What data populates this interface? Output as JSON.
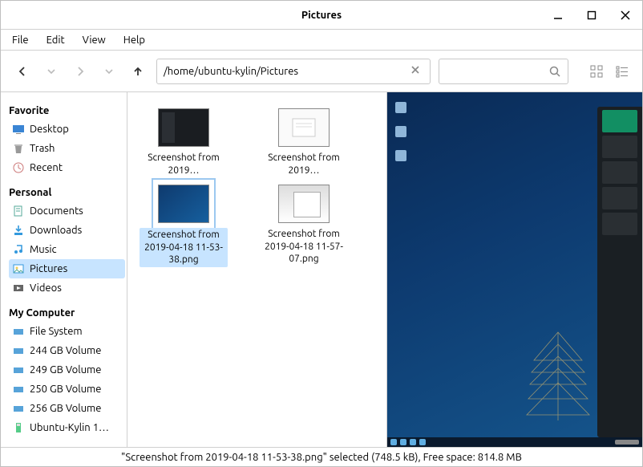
{
  "window": {
    "title": "Pictures"
  },
  "menu": [
    "File",
    "Edit",
    "View",
    "Help"
  ],
  "path": "/home/ubuntu-kylin/Pictures",
  "sidebar": {
    "favorite": {
      "label": "Favorite",
      "items": [
        "Desktop",
        "Trash",
        "Recent"
      ]
    },
    "personal": {
      "label": "Personal",
      "items": [
        "Documents",
        "Downloads",
        "Music",
        "Pictures",
        "Videos"
      ],
      "selected": 3
    },
    "computer": {
      "label": "My Computer",
      "items": [
        "File System",
        "244 GB Volume",
        "249 GB Volume",
        "250 GB Volume",
        "256 GB Volume",
        "Ubuntu-Kylin 1…"
      ]
    }
  },
  "files": [
    {
      "label": "Screenshot from 2019…"
    },
    {
      "label": "Screenshot from 2019…"
    },
    {
      "label": "Screenshot from 2019-04-18 11-53-38.png",
      "selected": true
    },
    {
      "label": "Screenshot from 2019-04-18 11-57-07.png"
    }
  ],
  "status": "\"Screenshot from 2019-04-18 11-53-38.png\" selected (748.5 kB), Free space: 814.8 MB"
}
